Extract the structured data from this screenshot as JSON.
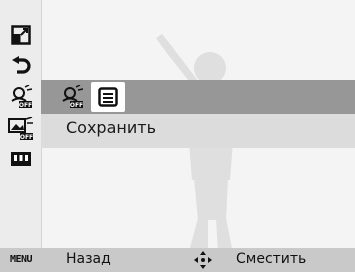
{
  "icons": {
    "aspect": "aspect-ratio-icon",
    "rotate": "rotate-left-icon",
    "effect_off": "face-effect-off-icon",
    "photo_edit_off": "photo-edit-off-icon",
    "film": "film-frames-icon",
    "save": "save-icon",
    "move": "directional-pad-icon"
  },
  "option": {
    "label": "Сохранить"
  },
  "bottom_bar": {
    "menu_tag": "MENU",
    "back_label": "Назад",
    "move_label": "Сместить"
  },
  "colors": {
    "band": "#979797",
    "selection": "#ffffff",
    "background": "#f4f4f4"
  }
}
